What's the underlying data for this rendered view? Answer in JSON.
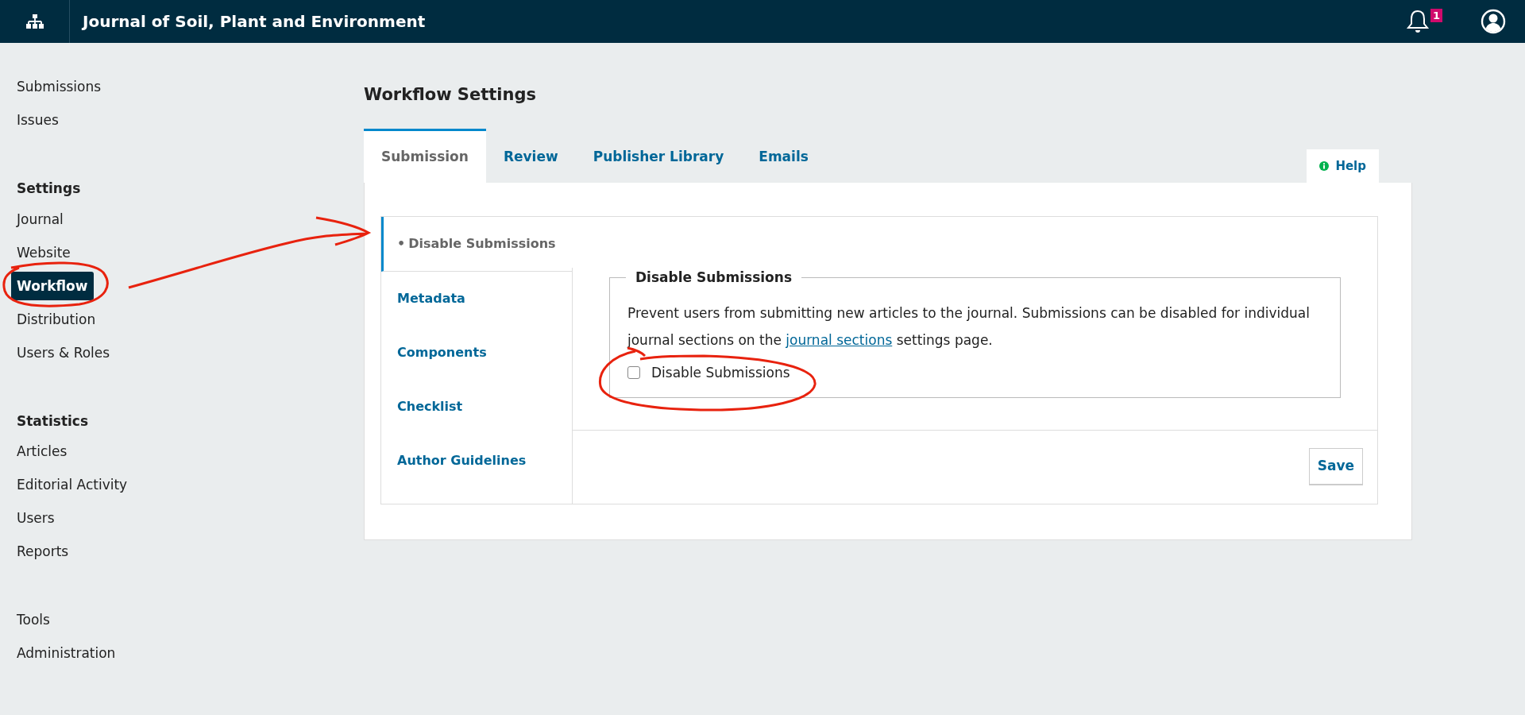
{
  "header": {
    "title": "Journal of Soil, Plant and Environment",
    "notification_count": "1"
  },
  "sidebar": {
    "sections": [
      {
        "items": [
          {
            "label": "Submissions",
            "selected": false
          },
          {
            "label": "Issues",
            "selected": false
          }
        ]
      },
      {
        "heading": "Settings",
        "items": [
          {
            "label": "Journal",
            "selected": false
          },
          {
            "label": "Website",
            "selected": false
          },
          {
            "label": "Workflow",
            "selected": true
          },
          {
            "label": "Distribution",
            "selected": false
          },
          {
            "label": "Users & Roles",
            "selected": false
          }
        ]
      },
      {
        "heading": "Statistics",
        "items": [
          {
            "label": "Articles",
            "selected": false
          },
          {
            "label": "Editorial Activity",
            "selected": false
          },
          {
            "label": "Users",
            "selected": false
          },
          {
            "label": "Reports",
            "selected": false
          }
        ]
      },
      {
        "items": [
          {
            "label": "Tools",
            "selected": false
          },
          {
            "label": "Administration",
            "selected": false
          }
        ]
      }
    ]
  },
  "page_title": "Workflow Settings",
  "tabs": [
    {
      "label": "Submission",
      "selected": true
    },
    {
      "label": "Review",
      "selected": false
    },
    {
      "label": "Publisher Library",
      "selected": false
    },
    {
      "label": "Emails",
      "selected": false
    }
  ],
  "help_button": "Help",
  "side_tabs": [
    {
      "marker": "•",
      "label": "Disable Submissions",
      "selected": true
    },
    {
      "label": "Metadata",
      "selected": false
    },
    {
      "label": "Components",
      "selected": false
    },
    {
      "label": "Checklist",
      "selected": false
    },
    {
      "label": "Author Guidelines",
      "selected": false
    }
  ],
  "fieldset": {
    "legend": "Disable Submissions",
    "description_before": "Prevent users from submitting new articles to the journal. Submissions can be disabled for individual journal sections on the",
    "link": "journal sections",
    "description_after": "settings page.",
    "checkbox": {
      "label": "Disable Submissions",
      "checked": false
    }
  },
  "save_button": "Save"
}
